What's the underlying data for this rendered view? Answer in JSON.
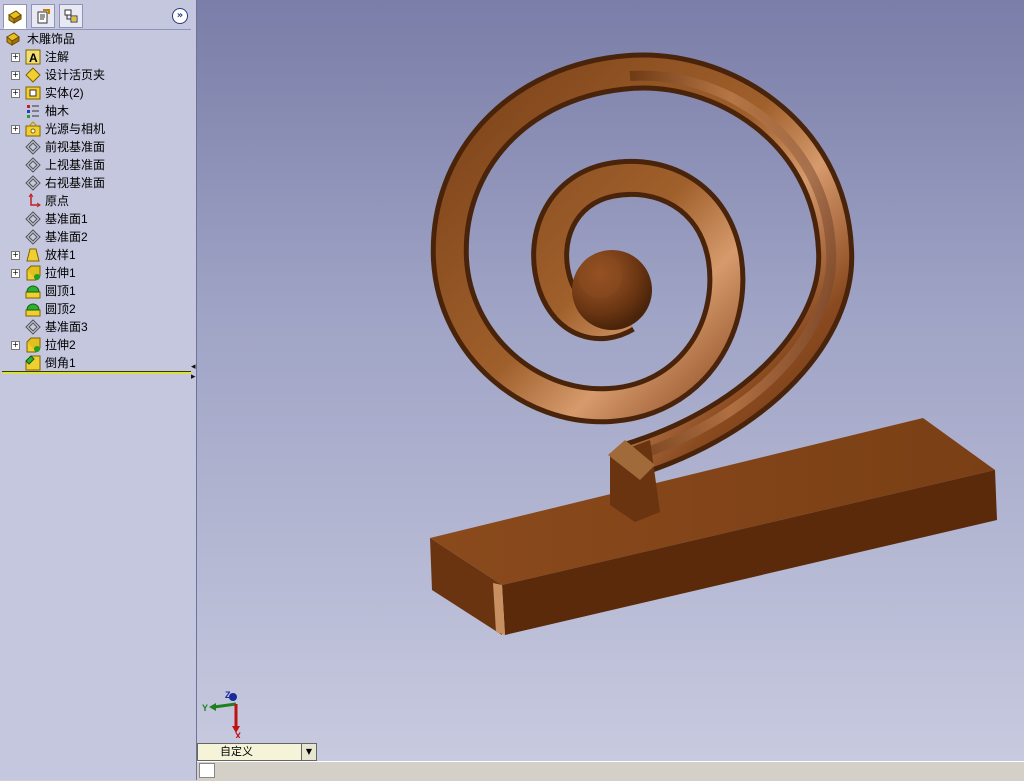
{
  "feature_tree": {
    "root": "木雕饰品",
    "items": [
      {
        "label": "注解",
        "icon": "annotations-icon",
        "expandable": true
      },
      {
        "label": "设计活页夹",
        "icon": "design-binder-icon",
        "expandable": true
      },
      {
        "label": "实体(2)",
        "icon": "solid-bodies-icon",
        "expandable": true
      },
      {
        "label": "柚木",
        "icon": "material-icon",
        "expandable": false
      },
      {
        "label": "光源与相机",
        "icon": "lights-cameras-icon",
        "expandable": true
      },
      {
        "label": "前视基准面",
        "icon": "plane-icon",
        "expandable": false
      },
      {
        "label": "上视基准面",
        "icon": "plane-icon",
        "expandable": false
      },
      {
        "label": "右视基准面",
        "icon": "plane-icon",
        "expandable": false
      },
      {
        "label": "原点",
        "icon": "origin-icon",
        "expandable": false
      },
      {
        "label": "基准面1",
        "icon": "plane-icon",
        "expandable": false
      },
      {
        "label": "基准面2",
        "icon": "plane-icon",
        "expandable": false
      },
      {
        "label": "放样1",
        "icon": "loft-icon",
        "expandable": true
      },
      {
        "label": "拉伸1",
        "icon": "extrude-icon",
        "expandable": true
      },
      {
        "label": "圆顶1",
        "icon": "dome-icon",
        "expandable": false
      },
      {
        "label": "圆顶2",
        "icon": "dome-icon",
        "expandable": false
      },
      {
        "label": "基准面3",
        "icon": "plane-icon",
        "expandable": false
      },
      {
        "label": "拉伸2",
        "icon": "extrude-icon",
        "expandable": true
      },
      {
        "label": "倒角1",
        "icon": "chamfer-icon",
        "expandable": false
      }
    ]
  },
  "panel_tabs": [
    {
      "name": "feature-manager-tab",
      "icon": "feature-manager-icon"
    },
    {
      "name": "property-manager-tab",
      "icon": "property-manager-icon"
    },
    {
      "name": "configuration-manager-tab",
      "icon": "configuration-manager-icon"
    }
  ],
  "expand_button_glyph": "»",
  "triad": {
    "x": "X",
    "y": "Y",
    "z": "Z"
  },
  "view_orientation": {
    "current": "自定义"
  },
  "colors": {
    "viewport_top": "#7a7ea8",
    "viewport_bottom": "#c9cbe0",
    "wood_base": "#7a4118",
    "wood_highlight": "#d69a6c",
    "panel_bg": "#c4c7dd"
  }
}
